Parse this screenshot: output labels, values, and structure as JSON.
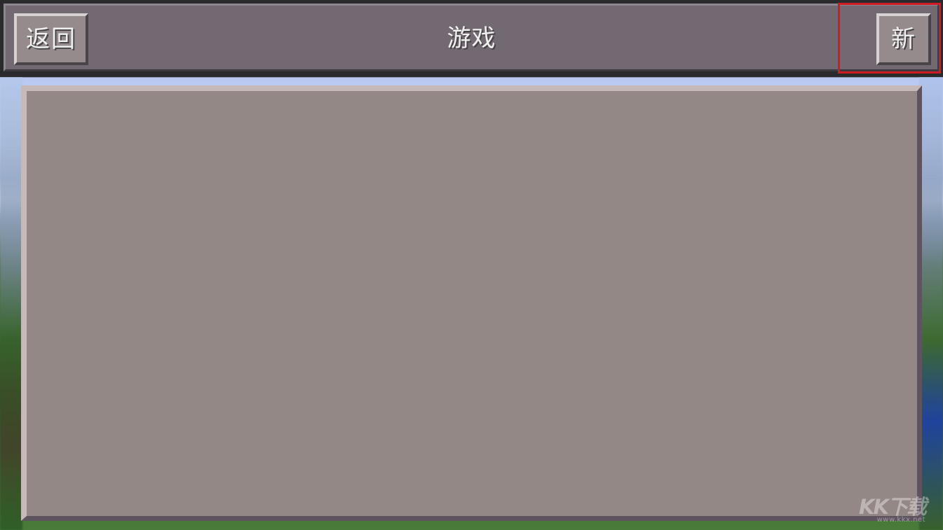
{
  "header": {
    "back_label": "返回",
    "title": "游戏",
    "new_label": "新"
  },
  "watermark": {
    "main": "KK下载",
    "sub": "www.kkx.net"
  },
  "colors": {
    "header_bg": "#726972",
    "button_bg": "#958b8d",
    "panel_bg": "#938885",
    "highlight": "#d11b23"
  }
}
